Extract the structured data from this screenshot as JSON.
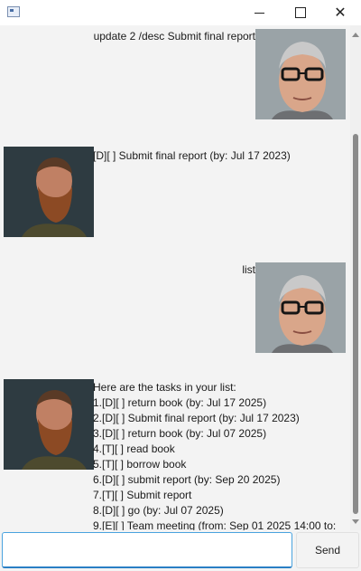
{
  "window": {
    "app_icon": "window-icon",
    "minimize_icon": "minimize-icon",
    "maximize_icon": "maximize-icon",
    "close_icon": "close-icon",
    "close_glyph": "✕"
  },
  "messages": [
    {
      "sender": "user",
      "text": "update 2 /desc Submit final report",
      "avatar": "user-avatar"
    },
    {
      "sender": "bot",
      "text": "[D][ ] Submit final report (by: Jul 17 2023)",
      "avatar": "bot-avatar"
    },
    {
      "sender": "user",
      "text": "list",
      "avatar": "user-avatar"
    },
    {
      "sender": "bot",
      "avatar": "bot-avatar",
      "lines": [
        "Here are the tasks in your list:",
        "1.[D][ ] return book (by: Jul 17 2025)",
        "2.[D][ ] Submit final report (by: Jul 17 2023)",
        "3.[D][ ] return book (by: Jul 07 2025)",
        "4.[T][ ] read book",
        "5.[T][ ] borrow book",
        "6.[D][ ] submit report (by: Sep 20 2025)",
        "7.[T][ ] Submit report",
        "8.[D][ ] go (by: Jul 07 2025)",
        "9.[E][ ] Team meeting (from: Sep 01 2025 14:00 to:"
      ]
    }
  ],
  "input": {
    "value": "",
    "placeholder": ""
  },
  "send_button": {
    "label": "Send"
  }
}
